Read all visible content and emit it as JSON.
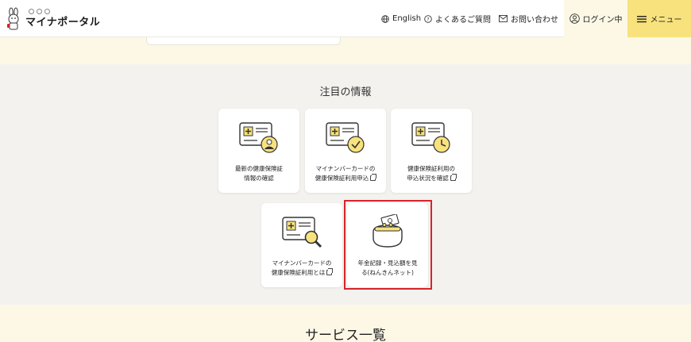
{
  "header": {
    "logo_text": "マイナポータル",
    "english_label": "English",
    "faq_label": "よくあるご質問",
    "contact_label": "お問い合わせ",
    "login_label": "ログイン中",
    "menu_label": "メニュー"
  },
  "featured": {
    "title": "注目の情報",
    "tiles": [
      {
        "line1": "最新の健康保険証",
        "line2": "情報の確認",
        "icon": "insurance-card-person-icon"
      },
      {
        "line1": "マイナンバーカードの",
        "line2": "健康保険証利用申込",
        "icon": "insurance-card-check-icon"
      },
      {
        "line1": "健康保険証利用の",
        "line2": "申込状況を確認",
        "icon": "insurance-card-clock-icon"
      },
      {
        "line1": "マイナンバーカードの",
        "line2": "健康保険証利用とは",
        "icon": "insurance-card-magnifier-icon"
      },
      {
        "line1": "年金記録・見込額を見",
        "line2": "る(ねんきんネット)",
        "icon": "coin-purse-icon"
      }
    ]
  },
  "services": {
    "title": "サービス一覧"
  },
  "colors": {
    "accent_yellow": "#f7e27d",
    "cream": "#fdf8e6",
    "highlight_red": "#d8242a"
  }
}
